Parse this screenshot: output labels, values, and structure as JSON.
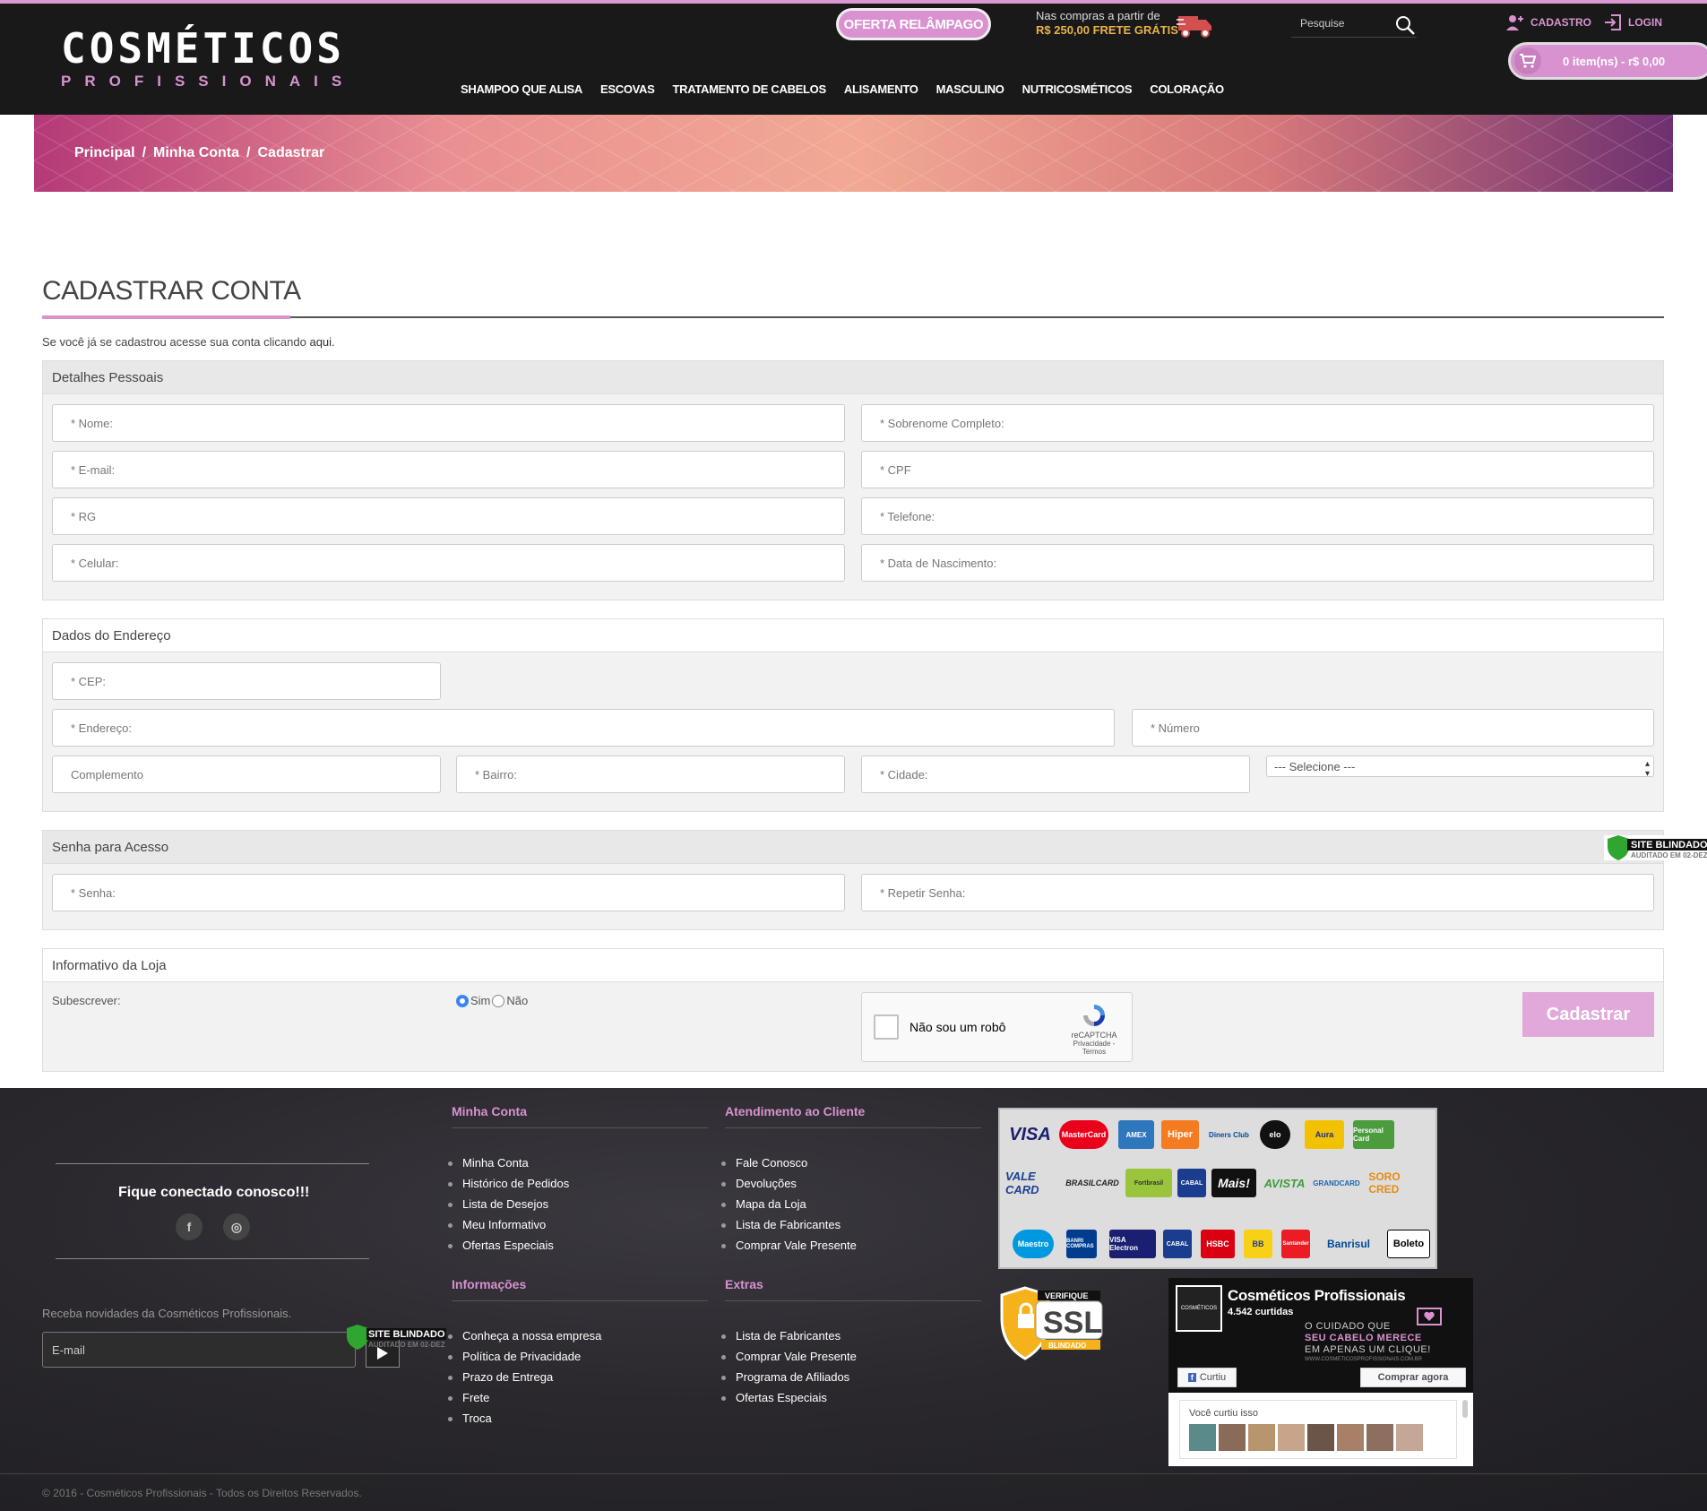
{
  "header": {
    "logo_line1": "COSMÉTICOS",
    "logo_line2": "PROFISSIONAIS",
    "flash_sale": "OFERTA RELÂMPAGO",
    "shipping_line1": "Nas compras a partir de",
    "shipping_line2": "R$ 250,00 FRETE GRÁTIS",
    "search_placeholder": "Pesquise",
    "register": "CADASTRO",
    "login": "LOGIN",
    "cart": "0 item(ns) - r$ 0,00",
    "accent_color": "#d892cf",
    "nav": [
      "SHAMPOO QUE ALISA",
      "ESCOVAS",
      "TRATAMENTO DE CABELOS",
      "ALISAMENTO",
      "MASCULINO",
      "NUTRICOSMÉTICOS",
      "COLORAÇÃO"
    ]
  },
  "breadcrumb": [
    "Principal",
    "Minha Conta",
    "Cadastrar"
  ],
  "page": {
    "title": "CADASTRAR CONTA",
    "intro": "Se você já se cadastrou acesse sua conta clicando ",
    "intro_link": "aqui",
    "intro_end": "."
  },
  "personal": {
    "heading": "Detalhes Pessoais",
    "first_name": "* Nome:",
    "last_name": "* Sobrenome Completo:",
    "email": "* E-mail:",
    "cpf": "* CPF",
    "rg": "* RG",
    "phone": "* Telefone:",
    "mobile": "* Celular:",
    "birth": "* Data de Nascimento:"
  },
  "address": {
    "heading": "Dados do Endereço",
    "cep": "* CEP:",
    "street": "* Endereço:",
    "number": "* Número",
    "complement": "Complemento",
    "district": "* Bairro:",
    "city": "* Cidade:",
    "state_select": "--- Selecione ---"
  },
  "password": {
    "heading": "Senha para Acesso",
    "password": "* Senha:",
    "confirm": "* Repetir Senha:"
  },
  "newsletter": {
    "heading": "Informativo da Loja",
    "subscribe_label": "Subescrever:",
    "yes": "Sim",
    "no": "Não",
    "captcha_label": "Não sou um robô",
    "captcha_brand": "reCAPTCHA",
    "captcha_links": "Privacidade - Termos",
    "submit": "Cadastrar"
  },
  "badges": {
    "site_blindado": "SITE BLINDADO",
    "audited": "AUDITADO EM 02-DEZ",
    "ssl_top": "VERIFIQUE",
    "ssl": "SSL",
    "ssl_bottom": "BLINDADO"
  },
  "footer": {
    "stay_connected": "Fique conectado conosco!!!",
    "social": [
      "f",
      "◎"
    ],
    "news_text": "Receba novidades da Cosméticos Profissionais.",
    "news_placeholder": "E-mail",
    "col1_title": "Minha Conta",
    "col1": [
      "Minha Conta",
      "Histórico de Pedidos",
      "Lista de Desejos",
      "Meu Informativo",
      "Ofertas Especiais"
    ],
    "col2_title": "Atendimento ao Cliente",
    "col2": [
      "Fale Conosco",
      "Devoluções",
      "Mapa da Loja",
      "Lista de Fabricantes",
      "Comprar Vale Presente"
    ],
    "col3_title": "Informações",
    "col3": [
      "Conheça a nossa empresa",
      "Política de Privacidade",
      "Prazo de Entrega",
      "Frete",
      "Troca"
    ],
    "col4_title": "Extras",
    "col4": [
      "Lista de Fabricantes",
      "Comprar Vale Presente",
      "Programa de Afiliados",
      "Ofertas Especiais"
    ],
    "payments": [
      "VISA",
      "MasterCard",
      "AMEX",
      "Hiper",
      "Diners Club",
      "elo",
      "Aura",
      "Personal Card",
      "VALE CARD",
      "BRASILCARD",
      "Fortbrasil",
      "CABAL",
      "Mais!",
      "AVISTA",
      "GRANDCARD",
      "SORO CRED",
      "Maestro",
      "BANRI COMPRAS",
      "VISA Electron",
      "CABAL",
      "HSBC",
      "BB",
      "Santander",
      "Banrisul",
      "Boleto"
    ],
    "fb_name": "Cosméticos Profissionais",
    "fb_likes": "4.542 curtidas",
    "fb_slogan1": "O CUIDADO QUE",
    "fb_slogan2": "SEU CABELO MERECE",
    "fb_slogan3": "EM APENAS UM CLIQUE!",
    "fb_url": "WWW.COSMETICOSPROFISSIONAIS.COM.BR",
    "fb_liked": "Curtiu",
    "fb_buy": "Comprar agora",
    "fb_you_liked": "Você curtiu isso",
    "copyright": "© 2016 - Cosméticos Profissionais - Todos os Direitos Reservados."
  }
}
